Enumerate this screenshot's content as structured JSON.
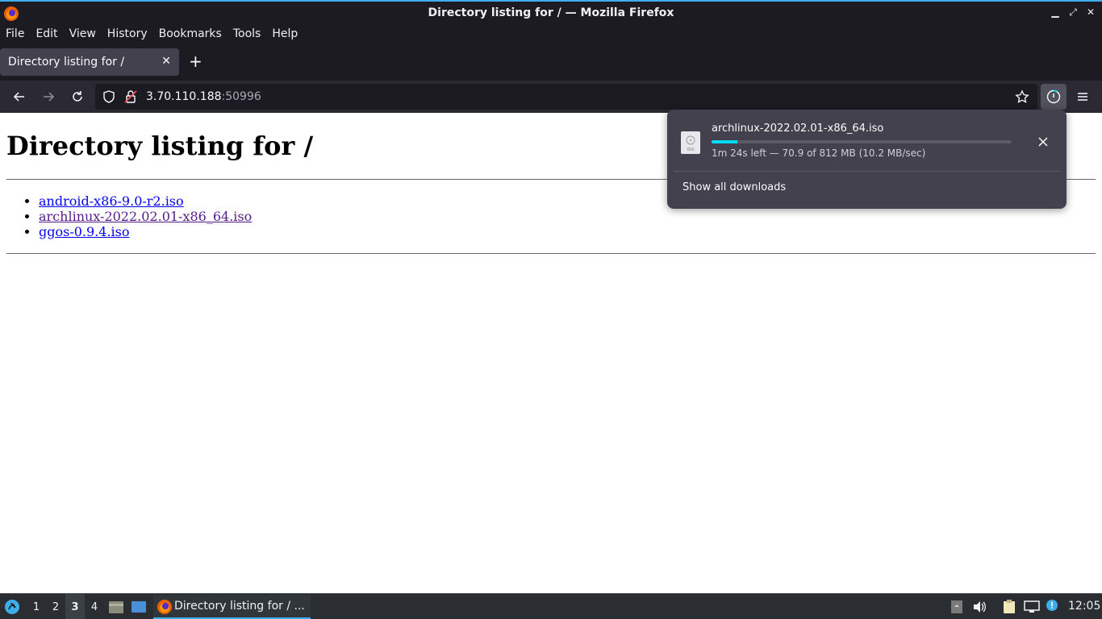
{
  "window": {
    "title": "Directory listing for / — Mozilla Firefox"
  },
  "menubar": {
    "items": [
      "File",
      "Edit",
      "View",
      "History",
      "Bookmarks",
      "Tools",
      "Help"
    ]
  },
  "tab": {
    "label": "Directory listing for /"
  },
  "urlbar": {
    "host": "3.70.110.188",
    "port": ":50996"
  },
  "page": {
    "heading": "Directory listing for /",
    "links": [
      "android-x86-9.0-r2.iso",
      "archlinux-2022.02.01-x86_64.iso",
      "ggos-0.9.4.iso"
    ]
  },
  "downloads_panel": {
    "file_name": "archlinux-2022.02.01-x86_64.iso",
    "file_icon_label": "ISO",
    "status": "1m 24s left — 70.9 of 812 MB (10.2 MB/sec)",
    "progress_fraction": 0.087,
    "show_all_label": "Show all downloads"
  },
  "taskbar": {
    "workspaces": [
      "1",
      "2",
      "3",
      "4"
    ],
    "active_workspace": "3",
    "task_label": "Directory listing for / ...",
    "clock": "12:05"
  },
  "colors": {
    "accent": "#3daee9",
    "progress": "#00ddff",
    "link": "#0000ee",
    "visited_link": "#551a8b"
  }
}
